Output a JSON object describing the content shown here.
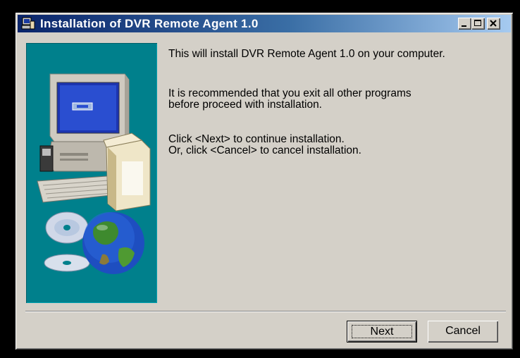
{
  "window": {
    "title": "Installation of DVR Remote Agent 1.0",
    "controls": {
      "minimize": "minimize-icon",
      "maximize": "maximize-icon",
      "close": "close-icon"
    }
  },
  "content": {
    "line1": "This will install DVR Remote Agent 1.0 on your computer.",
    "line2a": "It is recommended that you exit all other programs",
    "line2b": "before proceed with installation.",
    "line3a": "Click <Next> to continue installation.",
    "line3b": "Or, click <Cancel> to cancel installation."
  },
  "buttons": {
    "next": "Next",
    "cancel": "Cancel"
  },
  "colors": {
    "titlebar_start": "#0a246a",
    "titlebar_end": "#a6caf0",
    "panel": "#00808c",
    "dialog": "#d4d0c8"
  }
}
